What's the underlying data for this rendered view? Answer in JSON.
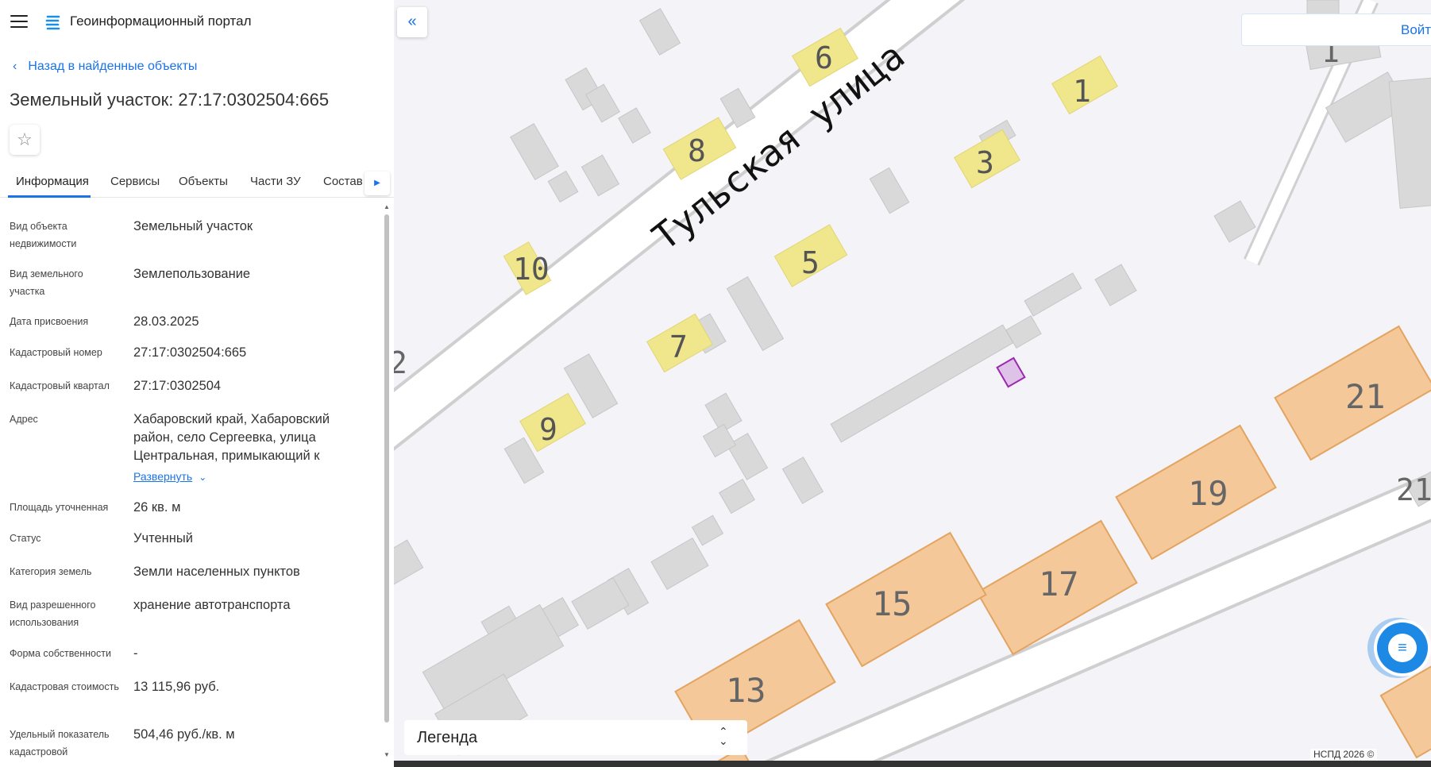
{
  "app": {
    "title": "Геоинформационный портал"
  },
  "nav": {
    "back_label": "Назад в найденные объекты"
  },
  "object": {
    "title": "Земельный участок: 27:17:0302504:665"
  },
  "tabs": [
    {
      "label": "Информация",
      "active": true
    },
    {
      "label": "Сервисы"
    },
    {
      "label": "Объекты"
    },
    {
      "label": "Части ЗУ"
    },
    {
      "label": "Состав"
    }
  ],
  "info": {
    "rows": [
      {
        "label": "Вид объекта недвижимости",
        "value": "Земельный участок"
      },
      {
        "label": "Вид земельного участка",
        "value": "Землепользование"
      },
      {
        "label": "Дата присвоения",
        "value": "28.03.2025"
      },
      {
        "label": "Кадастровый номер",
        "value": "27:17:0302504:665"
      },
      {
        "label": "Кадастровый квартал",
        "value": "27:17:0302504"
      },
      {
        "label": "Адрес",
        "value": "Хабаровский край, Хабаровский район, село Сергеевка, улица Центральная, примыкающий к"
      },
      {
        "label": "Площадь уточненная",
        "value": "26 кв. м"
      },
      {
        "label": "Статус",
        "value": "Учтенный"
      },
      {
        "label": "Категория земель",
        "value": "Земли населенных пунктов"
      },
      {
        "label": "Вид разрешенного использования",
        "value": "хранение автотранспорта"
      },
      {
        "label": "Форма собственности",
        "value": "-"
      },
      {
        "label": "Кадастровая стоимость",
        "value": "13 115,96 руб."
      },
      {
        "label": "Удельный показатель кадастровой",
        "value": "504,46 руб./кв. м"
      }
    ],
    "expand_label": "Развернуть"
  },
  "map": {
    "street_label": "Тульская улица",
    "house_numbers_yellow": [
      "6",
      "1",
      "8",
      "3",
      "10",
      "5",
      "7",
      "9"
    ],
    "house_numbers_orange": [
      "21",
      "19",
      "17",
      "15",
      "13"
    ],
    "partial_labels": [
      "1",
      "2",
      "21"
    ],
    "login_label": "Войти",
    "legend_label": "Легенда",
    "copyright": "НСПД 2026 ©",
    "colors": {
      "yellow_building": "#f0e68c",
      "orange_building": "#f5c89a",
      "gray_building": "#d9d9d9",
      "selected_parcel": "#9c27b0",
      "accent": "#1a73e8"
    }
  }
}
